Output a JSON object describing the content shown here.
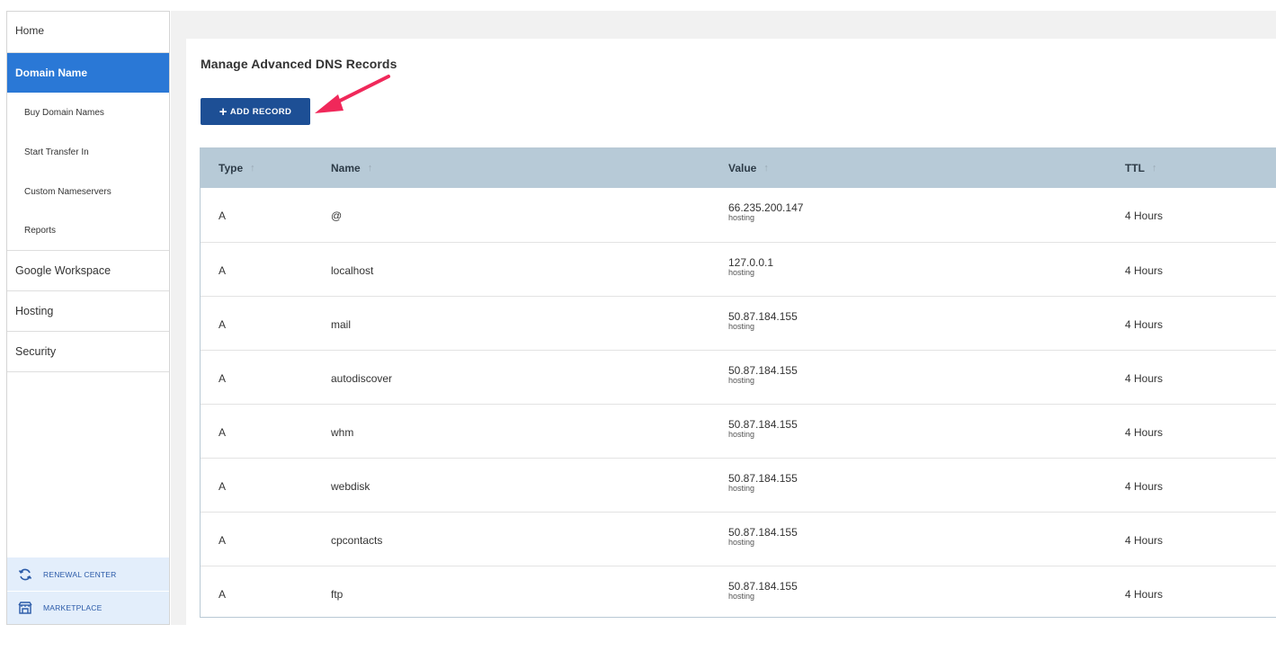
{
  "sidebar": {
    "home": "Home",
    "domain_name": "Domain Name",
    "sub_items": [
      "Buy Domain Names",
      "Start Transfer In",
      "Custom Nameservers",
      "Reports"
    ],
    "google_workspace": "Google Workspace",
    "hosting": "Hosting",
    "security": "Security",
    "renewal_center": "RENEWAL CENTER",
    "marketplace": "MARKETPLACE"
  },
  "main": {
    "title": "Manage Advanced DNS Records",
    "add_record_label": "ADD RECORD"
  },
  "table": {
    "headers": {
      "type": "Type",
      "name": "Name",
      "value": "Value",
      "ttl": "TTL"
    },
    "rows": [
      {
        "type": "A",
        "name": "@",
        "value": "66.235.200.147",
        "value_sub": "hosting",
        "ttl": "4 Hours"
      },
      {
        "type": "A",
        "name": "localhost",
        "value": "127.0.0.1",
        "value_sub": "hosting",
        "ttl": "4 Hours"
      },
      {
        "type": "A",
        "name": "mail",
        "value": "50.87.184.155",
        "value_sub": "hosting",
        "ttl": "4 Hours"
      },
      {
        "type": "A",
        "name": "autodiscover",
        "value": "50.87.184.155",
        "value_sub": "hosting",
        "ttl": "4 Hours"
      },
      {
        "type": "A",
        "name": "whm",
        "value": "50.87.184.155",
        "value_sub": "hosting",
        "ttl": "4 Hours"
      },
      {
        "type": "A",
        "name": "webdisk",
        "value": "50.87.184.155",
        "value_sub": "hosting",
        "ttl": "4 Hours"
      },
      {
        "type": "A",
        "name": "cpcontacts",
        "value": "50.87.184.155",
        "value_sub": "hosting",
        "ttl": "4 Hours"
      },
      {
        "type": "A",
        "name": "ftp",
        "value": "50.87.184.155",
        "value_sub": "hosting",
        "ttl": "4 Hours"
      }
    ]
  },
  "colors": {
    "active_nav": "#2a78d6",
    "button": "#1d4f95",
    "table_header": "#b7cad7",
    "arrow": "#f0285a"
  }
}
